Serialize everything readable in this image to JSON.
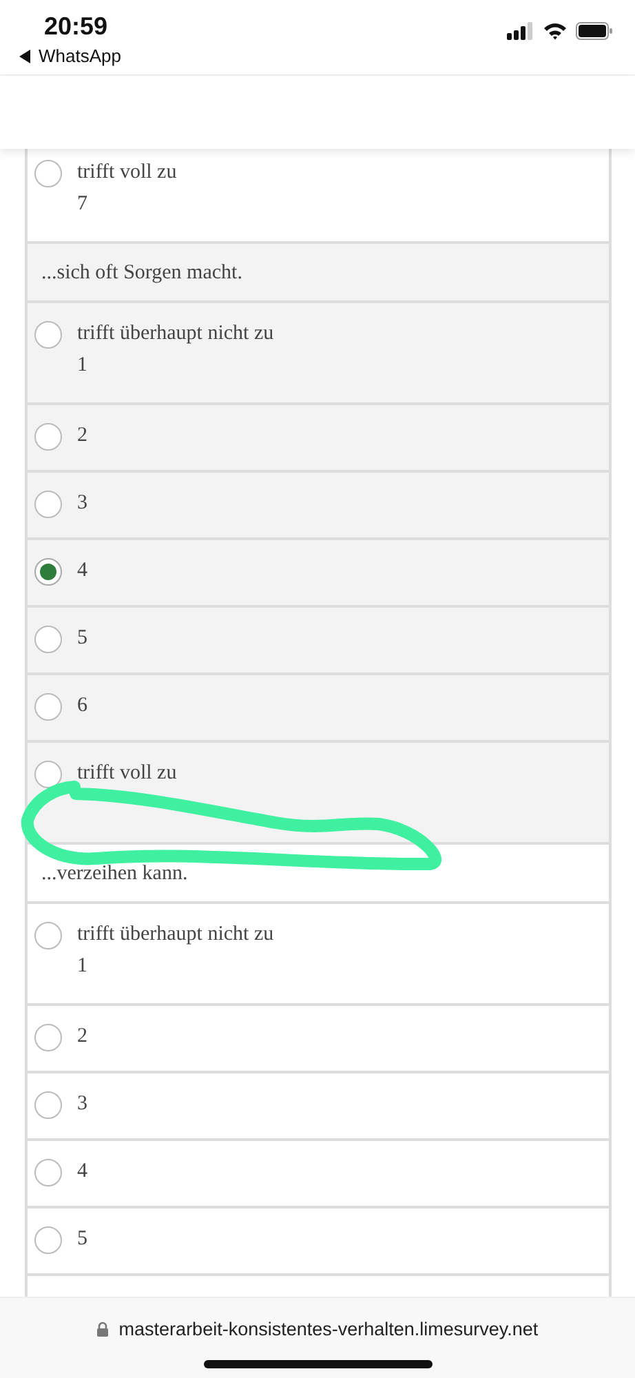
{
  "status_bar": {
    "time": "20:59",
    "back_label": "WhatsApp"
  },
  "groups": [
    {
      "shaded": false,
      "options": [
        {
          "label": "trifft voll zu",
          "value": "7",
          "selected": false
        }
      ]
    },
    {
      "statement": "...sich oft Sorgen macht.",
      "shaded": true,
      "options": [
        {
          "label": "trifft überhaupt nicht zu",
          "value": "1",
          "selected": false
        },
        {
          "value": "2",
          "selected": false
        },
        {
          "value": "3",
          "selected": false
        },
        {
          "value": "4",
          "selected": true
        },
        {
          "value": "5",
          "selected": false
        },
        {
          "value": "6",
          "selected": false
        },
        {
          "label": "trifft voll zu",
          "selected": false
        }
      ]
    },
    {
      "statement": "...verzeihen kann.",
      "shaded": false,
      "options": [
        {
          "label": "trifft überhaupt nicht zu",
          "value": "1",
          "selected": false
        },
        {
          "value": "2",
          "selected": false
        },
        {
          "value": "3",
          "selected": false
        },
        {
          "value": "4",
          "selected": false
        },
        {
          "value": "5",
          "selected": false
        }
      ]
    }
  ],
  "address_bar": {
    "url": "masterarbeit-konsistentes-verhalten.limesurvey.net"
  }
}
